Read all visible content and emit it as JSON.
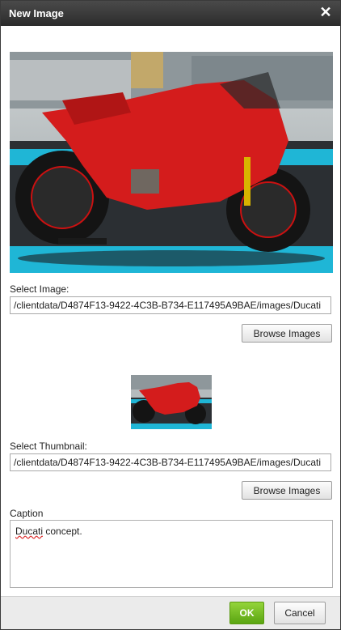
{
  "dialog": {
    "title": "New Image",
    "close_icon": "close-icon"
  },
  "image": {
    "label": "Select Image:",
    "path": "/clientdata/D4874F13-9422-4C3B-B734-E117495A9BAE/images/Ducati",
    "browse_label": "Browse Images"
  },
  "thumbnail": {
    "label": "Select Thumbnail:",
    "path": "/clientdata/D4874F13-9422-4C3B-B734-E117495A9BAE/images/Ducati",
    "browse_label": "Browse Images"
  },
  "caption": {
    "label": "Caption",
    "word1": "Ducati",
    "rest": " concept."
  },
  "footer": {
    "ok_label": "OK",
    "cancel_label": "Cancel"
  },
  "colors": {
    "titlebar": "#2c2c2c",
    "ok_button": "#6cb81e",
    "motorcycle": "#d41c1c",
    "track": "#1fb6d6"
  }
}
